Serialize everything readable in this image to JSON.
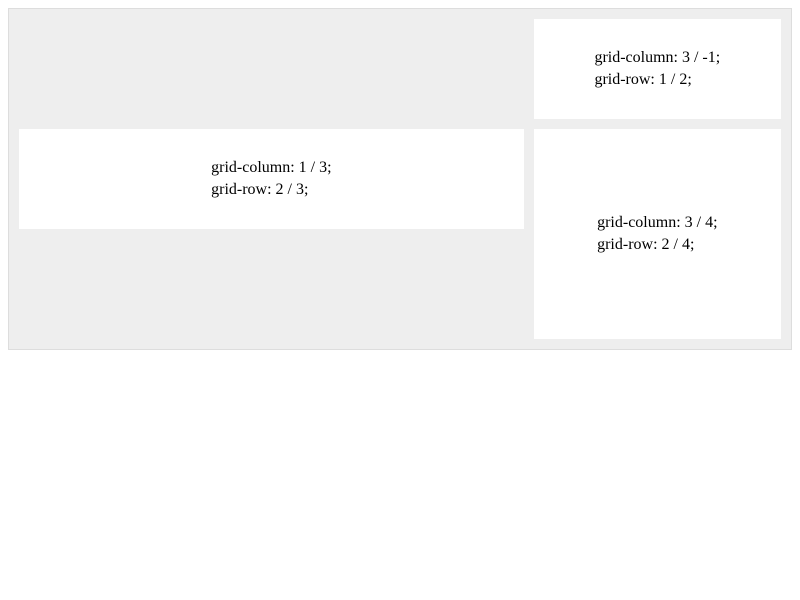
{
  "grid": {
    "items": [
      {
        "line1": "grid-column: 3 / -1;",
        "line2": "grid-row: 1 / 2;"
      },
      {
        "line1": "grid-column: 1 / 3;",
        "line2": "grid-row: 2 / 3;"
      },
      {
        "line1": "grid-column: 3 / 4;",
        "line2": "grid-row: 2 / 4;"
      }
    ]
  }
}
